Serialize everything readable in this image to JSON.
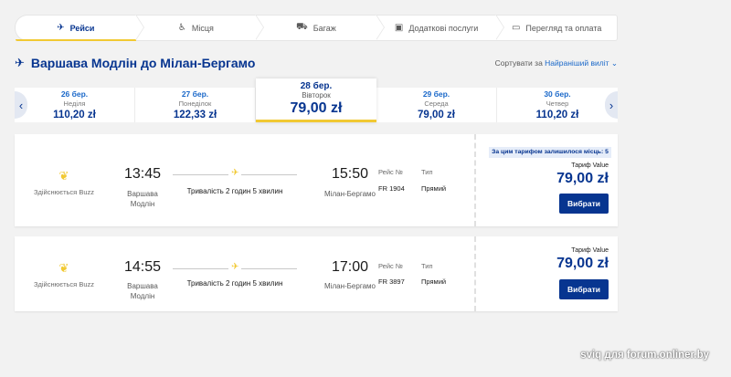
{
  "steps": [
    {
      "label": "Рейси",
      "icon": "plane-icon",
      "glyph": "✈"
    },
    {
      "label": "Місця",
      "icon": "seat-icon",
      "glyph": "♿"
    },
    {
      "label": "Багаж",
      "icon": "luggage-icon",
      "glyph": "⛟"
    },
    {
      "label": "Додаткові послуги",
      "icon": "services-icon",
      "glyph": "▣"
    },
    {
      "label": "Перегляд та оплата",
      "icon": "payment-icon",
      "glyph": "▭"
    }
  ],
  "route": {
    "plane_glyph": "✈",
    "title": "Варшава Модлін до Мілан-Бергамо"
  },
  "sort": {
    "label": "Сортувати за",
    "value": "Найраніший виліт ⌄"
  },
  "dates": {
    "prev_glyph": "‹",
    "next_glyph": "›",
    "cells": [
      {
        "date": "26 бер.",
        "weekday": "Неділя",
        "price": "110,20 zł"
      },
      {
        "date": "27 бер.",
        "weekday": "Понеділок",
        "price": "122,33 zł"
      },
      {
        "date": "",
        "weekday": "",
        "price": ""
      },
      {
        "date": "29 бер.",
        "weekday": "Середа",
        "price": "79,00 zł"
      },
      {
        "date": "30 бер.",
        "weekday": "Четвер",
        "price": "110,20 zł"
      }
    ],
    "selected": {
      "date": "28 бер.",
      "weekday": "Вівторок",
      "price": "79,00 zł"
    }
  },
  "flights": [
    {
      "airline": "Здійснюється Buzz",
      "airline_glyph": "❦",
      "dep_time": "13:45",
      "dep_city_1": "Варшава",
      "dep_city_2": "Модлін",
      "plane_glyph": "✈",
      "duration": "Тривалість 2 годин 5 хвилин",
      "arr_time": "15:50",
      "arr_city": "Мілан-Бергамо",
      "flight_label": "Рейс №",
      "flight_no": "FR 1904",
      "type_label": "Тип",
      "type_value": "Прямий",
      "seats_left": "За цим тарифом залишилося місць: 5",
      "fare_label": "Тариф Value",
      "fare_price": "79,00 zł",
      "select_label": "Вибрати"
    },
    {
      "airline": "Здійснюється Buzz",
      "airline_glyph": "❦",
      "dep_time": "14:55",
      "dep_city_1": "Варшава",
      "dep_city_2": "Модлін",
      "plane_glyph": "✈",
      "duration": "Тривалість 2 годин 5 хвилин",
      "arr_time": "17:00",
      "arr_city": "Мілан-Бергамо",
      "flight_label": "Рейс №",
      "flight_no": "FR 3897",
      "type_label": "Тип",
      "type_value": "Прямий",
      "fare_label": "Тариф Value",
      "fare_price": "79,00 zł",
      "select_label": "Вибрати"
    }
  ],
  "watermark": "sviq для forum.onliner.by",
  "colors": {
    "navy": "#073590",
    "accent_yellow": "#f1c933",
    "link_blue": "#1a68c9",
    "background": "#f2f2f2"
  }
}
